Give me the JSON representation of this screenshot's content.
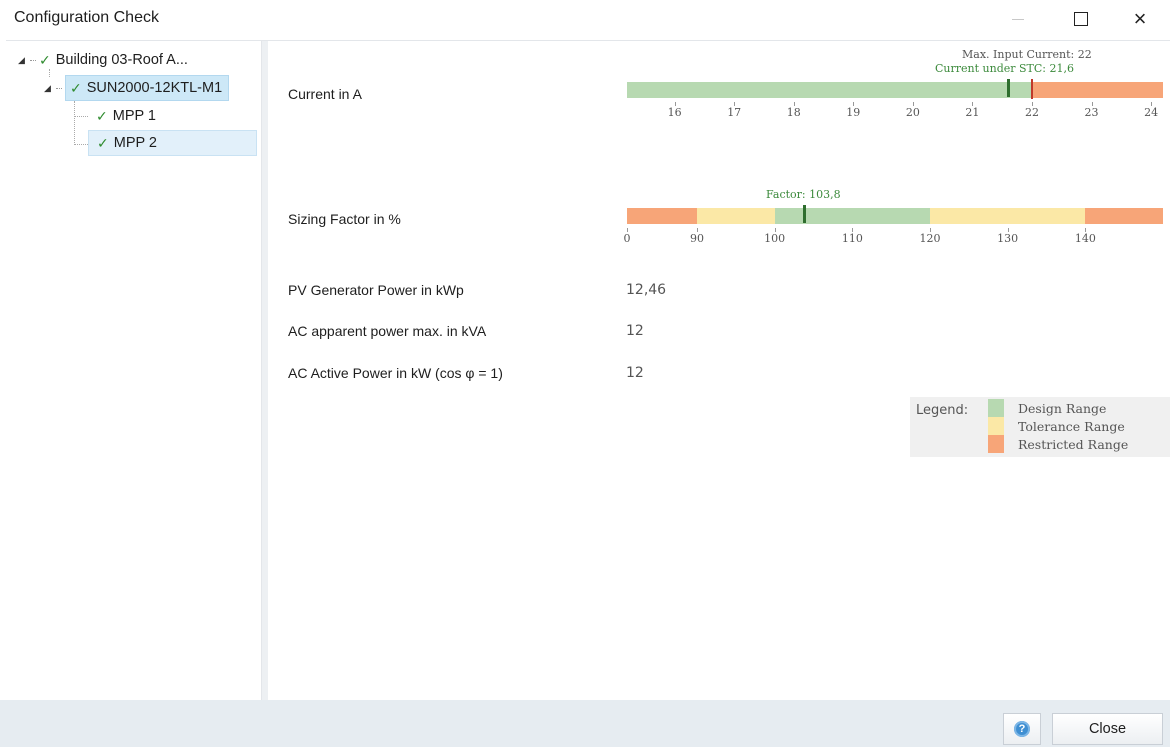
{
  "window": {
    "title": "Configuration Check",
    "minimize_icon": "minimize-icon",
    "maximize_icon": "maximize-icon",
    "close_icon": "close-icon",
    "close_glyph": "×"
  },
  "tree": {
    "expand_glyph": "◢",
    "check_glyph": "✓",
    "nodes": [
      {
        "label": "Building 03-Roof A...",
        "level": 0,
        "status": "ok"
      },
      {
        "label": "SUN2000-12KTL-M1",
        "level": 1,
        "status": "ok",
        "highlighted": true
      },
      {
        "label": "MPP 1",
        "level": 2,
        "status": "ok"
      },
      {
        "label": "MPP 2",
        "level": 2,
        "status": "ok",
        "selected": true
      }
    ]
  },
  "checks": {
    "current": {
      "label": "Current in A",
      "max_annotation": "Max. Input Current: 22",
      "stc_annotation": "Current under STC: 21,6",
      "max_input_current": 22,
      "current_under_stc": 21.6,
      "ticks": [
        "16",
        "17",
        "18",
        "19",
        "20",
        "21",
        "22",
        "23",
        "24"
      ],
      "design_range": [
        15.2,
        22
      ],
      "restricted_range": [
        22,
        24.2
      ]
    },
    "sizing": {
      "label": "Sizing Factor in %",
      "factor_annotation": "Factor: 103,8",
      "factor": 103.8,
      "ticks": [
        "0",
        "90",
        "100",
        "110",
        "120",
        "130",
        "140"
      ],
      "ranges": [
        {
          "from": 0,
          "to": 90,
          "type": "restricted"
        },
        {
          "from": 90,
          "to": 100,
          "type": "tolerance"
        },
        {
          "from": 100,
          "to": 120,
          "type": "design"
        },
        {
          "from": 120,
          "to": 140,
          "type": "tolerance"
        },
        {
          "from": 140,
          "to": 150,
          "type": "restricted"
        }
      ]
    },
    "rows": [
      {
        "label": "PV Generator Power in kWp",
        "value": "12,46"
      },
      {
        "label": "AC apparent power max. in kVA",
        "value": "12"
      },
      {
        "label": "AC Active Power in kW (cos φ = 1)",
        "value": "12"
      }
    ]
  },
  "legend": {
    "title": "Legend:",
    "items": [
      {
        "label": "Design Range",
        "color": "#b7d9b1"
      },
      {
        "label": "Tolerance Range",
        "color": "#fbe8a6"
      },
      {
        "label": "Restricted Range",
        "color": "#f7a578"
      }
    ]
  },
  "colors": {
    "design": "#b7d9b1",
    "tolerance": "#fbe8a6",
    "restricted": "#f7a578",
    "marker": "#2e6e2e",
    "annotation_green": "#3c8a3c"
  },
  "footer": {
    "help_icon": "help-icon",
    "help_glyph": "?",
    "close_label": "Close"
  }
}
